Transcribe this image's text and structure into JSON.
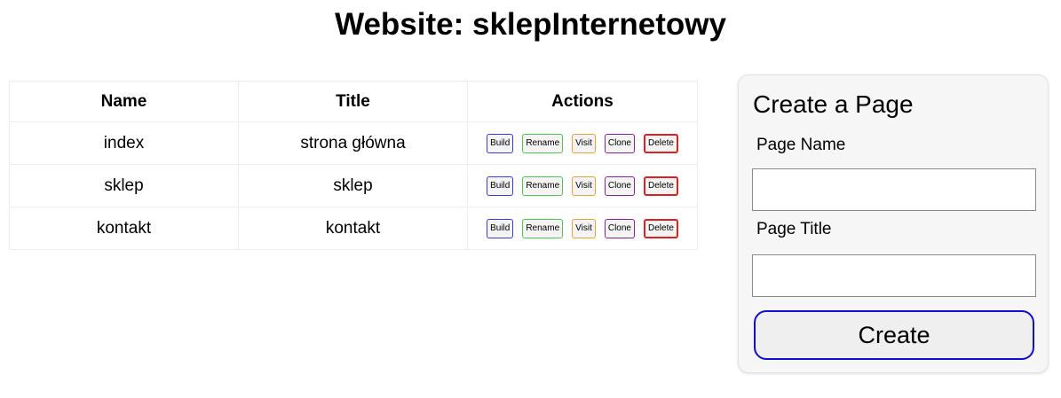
{
  "header": {
    "title": "Website: sklepInternetowy"
  },
  "table": {
    "columns": [
      "Name",
      "Title",
      "Actions"
    ],
    "rows": [
      {
        "name": "index",
        "title": "strona główna"
      },
      {
        "name": "sklep",
        "title": "sklep"
      },
      {
        "name": "kontakt",
        "title": "kontakt"
      }
    ],
    "actions": {
      "build": "Build",
      "rename": "Rename",
      "visit": "Visit",
      "clone": "Clone",
      "delete": "Delete"
    }
  },
  "create_form": {
    "heading": "Create a Page",
    "page_name_label": "Page Name",
    "page_name_value": "",
    "page_title_label": "Page Title",
    "page_title_value": "",
    "submit_label": "Create"
  },
  "colors": {
    "build": "#3b3bd6",
    "rename": "#47c94a",
    "visit": "#f0a032",
    "clone": "#8f1aa6",
    "delete": "#e02020",
    "create_border": "#1010d0"
  }
}
